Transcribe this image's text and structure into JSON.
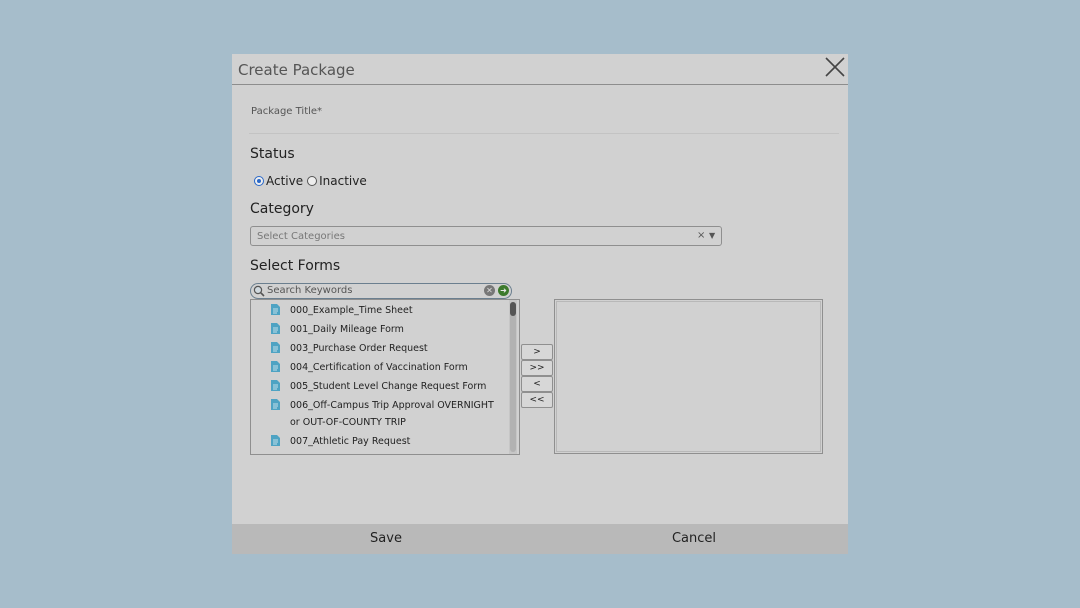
{
  "dialog": {
    "title": "Create Package",
    "package_title_label": "Package Title*",
    "status": {
      "label": "Status",
      "options": [
        {
          "label": "Active",
          "checked": true
        },
        {
          "label": "Inactive",
          "checked": false
        }
      ]
    },
    "category": {
      "label": "Category",
      "placeholder": "Select Categories",
      "clear_glyph": "×",
      "arrow_glyph": "▼"
    },
    "forms": {
      "label": "Select Forms",
      "search_placeholder": "Search Keywords",
      "available": [
        "000_Example_Time Sheet",
        "001_Daily Mileage Form",
        "003_Purchase Order Request",
        "004_Certification of Vaccination Form",
        "005_Student Level Change Request Form",
        "006_Off-Campus Trip Approval OVERNIGHT or OUT-OF-COUNTY TRIP",
        "007_Athletic Pay Request"
      ],
      "move_buttons": [
        ">",
        ">>",
        "<",
        "<<"
      ]
    },
    "footer": {
      "save_label": "Save",
      "cancel_label": "Cancel"
    }
  },
  "colors": {
    "backdrop": "#a6bdcb",
    "dialog_bg": "#d1d1d1",
    "icon_blue": "#4ea3c3",
    "radio_blue": "#2a68c8"
  }
}
